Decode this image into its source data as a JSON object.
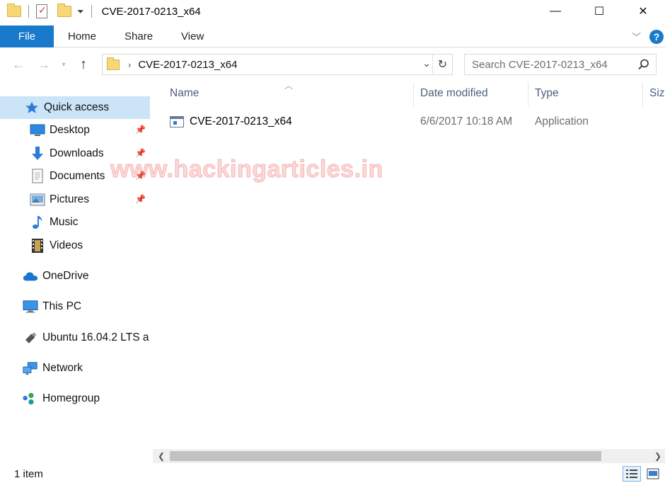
{
  "window": {
    "title": "CVE-2017-0213_x64",
    "minimize_icon": "—",
    "maximize_icon": "☐",
    "close_icon": "✕"
  },
  "ribbon": {
    "file_tab": "File",
    "tabs": [
      "Home",
      "Share",
      "View"
    ],
    "help_label": "?"
  },
  "address": {
    "path_segment": "CVE-2017-0213_x64",
    "search_placeholder": "Search CVE-2017-0213_x64"
  },
  "navigation": {
    "items": [
      {
        "label": "Quick access",
        "icon": "star-icon",
        "selected": true
      },
      {
        "label": "Desktop",
        "icon": "desktop-icon",
        "pinned": true
      },
      {
        "label": "Downloads",
        "icon": "download-arrow-icon",
        "pinned": true
      },
      {
        "label": "Documents",
        "icon": "document-icon",
        "pinned": true
      },
      {
        "label": "Pictures",
        "icon": "picture-icon",
        "pinned": true
      },
      {
        "label": "Music",
        "icon": "music-note-icon"
      },
      {
        "label": "Videos",
        "icon": "film-icon"
      },
      {
        "label": "OneDrive",
        "icon": "cloud-icon"
      },
      {
        "label": "This PC",
        "icon": "monitor-icon"
      },
      {
        "label": "Ubuntu 16.04.2 LTS a",
        "icon": "usb-drive-icon"
      },
      {
        "label": "Network",
        "icon": "network-icon"
      },
      {
        "label": "Homegroup",
        "icon": "homegroup-icon"
      }
    ]
  },
  "columns": {
    "name": "Name",
    "date_modified": "Date modified",
    "type": "Type",
    "size": "Size"
  },
  "files": [
    {
      "name": "CVE-2017-0213_x64",
      "date_modified": "6/6/2017 10:18 AM",
      "type": "Application"
    }
  ],
  "watermark": "www.hackingarticles.in",
  "status": {
    "item_count": "1 item"
  },
  "colors": {
    "accent": "#1979ca",
    "selection": "#cce4f7",
    "column_header": "#4c607a"
  }
}
